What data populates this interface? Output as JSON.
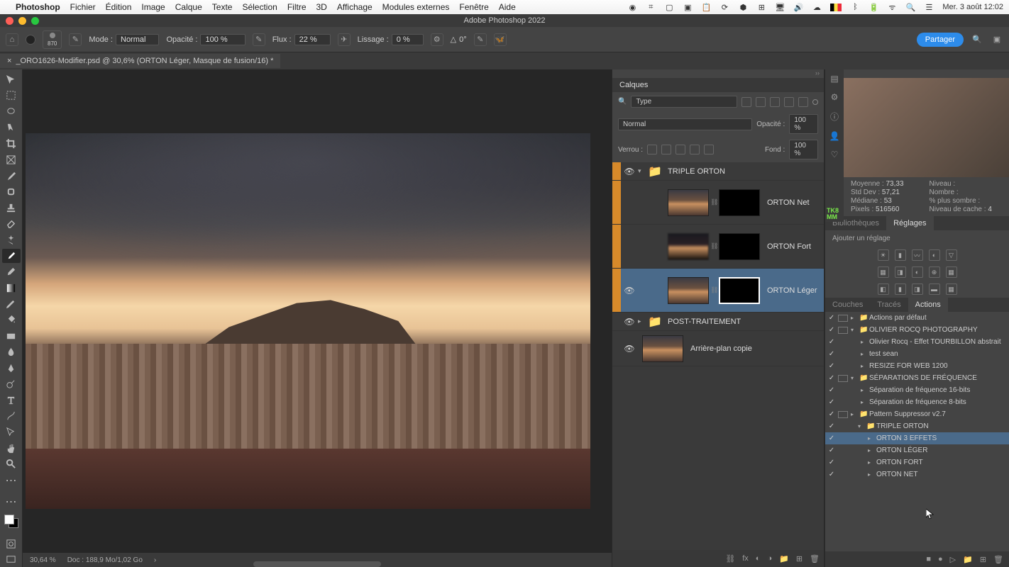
{
  "menubar": {
    "app": "Photoshop",
    "items": [
      "Fichier",
      "Édition",
      "Image",
      "Calque",
      "Texte",
      "Sélection",
      "Filtre",
      "3D",
      "Affichage",
      "Modules externes",
      "Fenêtre",
      "Aide"
    ],
    "datetime": "Mer. 3 août  12:02"
  },
  "window": {
    "title": "Adobe Photoshop 2022"
  },
  "optbar": {
    "home": "⌂",
    "brush_size": "870",
    "mode_label": "Mode :",
    "mode": "Normal",
    "opacity_label": "Opacité :",
    "opacity": "100 %",
    "flux_label": "Flux :",
    "flux": "22 %",
    "smooth_label": "Lissage :",
    "smooth": "0 %",
    "angle_label": "△",
    "angle": "0°",
    "share": "Partager"
  },
  "doctab": {
    "label": "_ORO1626-Modifier.psd @ 30,6% (ORTON Léger, Masque de fusion/16) *"
  },
  "status": {
    "zoom": "30,64 %",
    "doc": "Doc : 188,9 Mo/1,02 Go"
  },
  "layers_panel": {
    "title": "Calques",
    "kind": "Type",
    "blend": "Normal",
    "opacity_label": "Opacité :",
    "opacity": "100 %",
    "lock_label": "Verrou :",
    "fill_label": "Fond :",
    "fill": "100 %",
    "items": {
      "group1": "TRIPLE ORTON",
      "l1": "ORTON Net",
      "l2": "ORTON Fort",
      "l3": "ORTON Léger",
      "group2": "POST-TRAITEMENT",
      "l4": "Arrière-plan copie"
    }
  },
  "histo": {
    "mean_l": "Moyenne :",
    "mean": "73,33",
    "std_l": "Std Dev :",
    "std": "57,21",
    "med_l": "Médiane :",
    "med": "53",
    "px_l": "Pixels :",
    "px": "516560",
    "lvl_l": "Niveau :",
    "lvl": "",
    "cnt_l": "Nombre :",
    "cnt": "",
    "dark_l": "% plus sombre :",
    "dark": "",
    "cache_l": "Niveau de cache :",
    "cache": "4"
  },
  "tabs1": {
    "a": "Bibliothèques",
    "b": "Réglages"
  },
  "adj": {
    "hint": "Ajouter un réglage"
  },
  "tabs2": {
    "a": "Couches",
    "b": "Tracés",
    "c": "Actions"
  },
  "actions": {
    "r1": "Actions par défaut",
    "r2": "OLIVIER ROCQ PHOTOGRAPHY",
    "r3": "Olivier Rocq - Effet TOURBILLON abstrait",
    "r4": "test sean",
    "r5": "RESIZE FOR WEB 1200",
    "r6": "SÉPARATIONS DE FRÉQUENCE",
    "r7": "Séparation de fréquence 16-bits",
    "r8": "Séparation de fréquence 8-bits",
    "r9": "Pattern Suppressor v2.7",
    "r10": "TRIPLE ORTON",
    "r11": "ORTON 3 EFFETS",
    "r12": "ORTON LÉGER",
    "r13": "ORTON FORT",
    "r14": "ORTON NET"
  }
}
